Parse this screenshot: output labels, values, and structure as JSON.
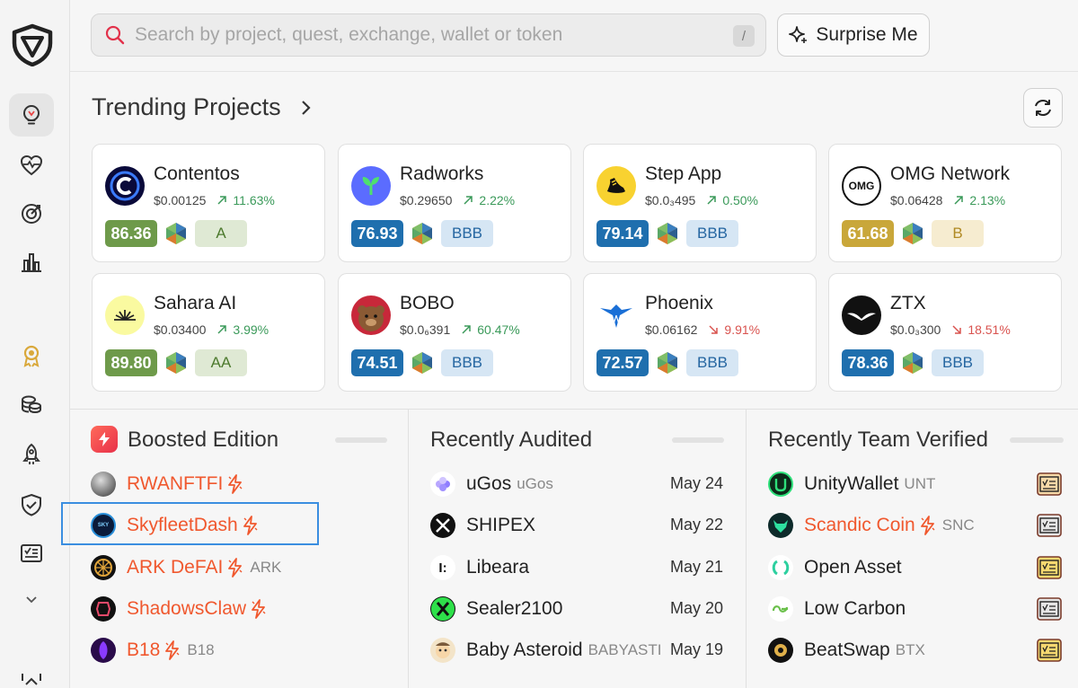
{
  "search": {
    "placeholder": "Search by project, quest, exchange, wallet or token",
    "shortcut": "/"
  },
  "surprise_label": "Surprise Me",
  "trending": {
    "title": "Trending Projects",
    "cards": [
      {
        "name": "Contentos",
        "price": "$0.00125",
        "change": "11.63%",
        "dir": "up",
        "score": "86.36",
        "score_color": "#6e9a4a",
        "rating": "A",
        "rating_bg": "#dfe9d4",
        "rating_fg": "#4d7a2e"
      },
      {
        "name": "Radworks",
        "price": "$0.29650",
        "change": "2.22%",
        "dir": "up",
        "score": "76.93",
        "score_color": "#1f6fae",
        "rating": "BBB",
        "rating_bg": "#d6e6f4",
        "rating_fg": "#2566a1"
      },
      {
        "name": "Step App",
        "price": "$0.0₃495",
        "change": "0.50%",
        "dir": "up",
        "score": "79.14",
        "score_color": "#1f6fae",
        "rating": "BBB",
        "rating_bg": "#d6e6f4",
        "rating_fg": "#2566a1"
      },
      {
        "name": "OMG Network",
        "price": "$0.06428",
        "change": "2.13%",
        "dir": "up",
        "score": "61.68",
        "score_color": "#c9a73a",
        "rating": "B",
        "rating_bg": "#f6ecd0",
        "rating_fg": "#b08a24"
      },
      {
        "name": "Sahara AI",
        "price": "$0.03400",
        "change": "3.99%",
        "dir": "up",
        "score": "89.80",
        "score_color": "#6e9a4a",
        "rating": "AA",
        "rating_bg": "#dfe9d4",
        "rating_fg": "#4d7a2e"
      },
      {
        "name": "BOBO",
        "price": "$0.0₆391",
        "change": "60.47%",
        "dir": "up",
        "score": "74.51",
        "score_color": "#1f6fae",
        "rating": "BBB",
        "rating_bg": "#d6e6f4",
        "rating_fg": "#2566a1"
      },
      {
        "name": "Phoenix",
        "price": "$0.06162",
        "change": "9.91%",
        "dir": "down",
        "score": "72.57",
        "score_color": "#1f6fae",
        "rating": "BBB",
        "rating_bg": "#d6e6f4",
        "rating_fg": "#2566a1"
      },
      {
        "name": "ZTX",
        "price": "$0.0₃300",
        "change": "18.51%",
        "dir": "down",
        "score": "78.36",
        "score_color": "#1f6fae",
        "rating": "BBB",
        "rating_bg": "#d6e6f4",
        "rating_fg": "#2566a1"
      }
    ]
  },
  "boosted": {
    "title": "Boosted Edition",
    "items": [
      {
        "name": "RWANFTFI",
        "ticker": ""
      },
      {
        "name": "SkyfleetDash",
        "ticker": ""
      },
      {
        "name": "ARK DeFAI",
        "ticker": "ARK"
      },
      {
        "name": "ShadowsClaw",
        "ticker": ""
      },
      {
        "name": "B18",
        "ticker": "B18"
      }
    ]
  },
  "audited": {
    "title": "Recently Audited",
    "items": [
      {
        "name": "uGos",
        "ticker": "uGos",
        "date": "May 24"
      },
      {
        "name": "SHIPEX",
        "ticker": "",
        "date": "May 22"
      },
      {
        "name": "Libeara",
        "ticker": "",
        "date": "May 21"
      },
      {
        "name": "Sealer2100",
        "ticker": "",
        "date": "May 20"
      },
      {
        "name": "Baby Asteroid",
        "ticker": "BABYASTI",
        "date": "May 19"
      }
    ]
  },
  "verified": {
    "title": "Recently Team Verified",
    "items": [
      {
        "name": "UnityWallet",
        "ticker": "UNT",
        "boosted": false
      },
      {
        "name": "Scandic Coin",
        "ticker": "SNC",
        "boosted": true
      },
      {
        "name": "Open Asset",
        "ticker": "",
        "boosted": false
      },
      {
        "name": "Low Carbon",
        "ticker": "",
        "boosted": false
      },
      {
        "name": "BeatSwap",
        "ticker": "BTX",
        "boosted": false
      }
    ]
  },
  "colors": {
    "accent_orange": "#f0582e",
    "up": "#3b9a5a",
    "down": "#d9534f",
    "highlight": "#3b8ee0"
  }
}
